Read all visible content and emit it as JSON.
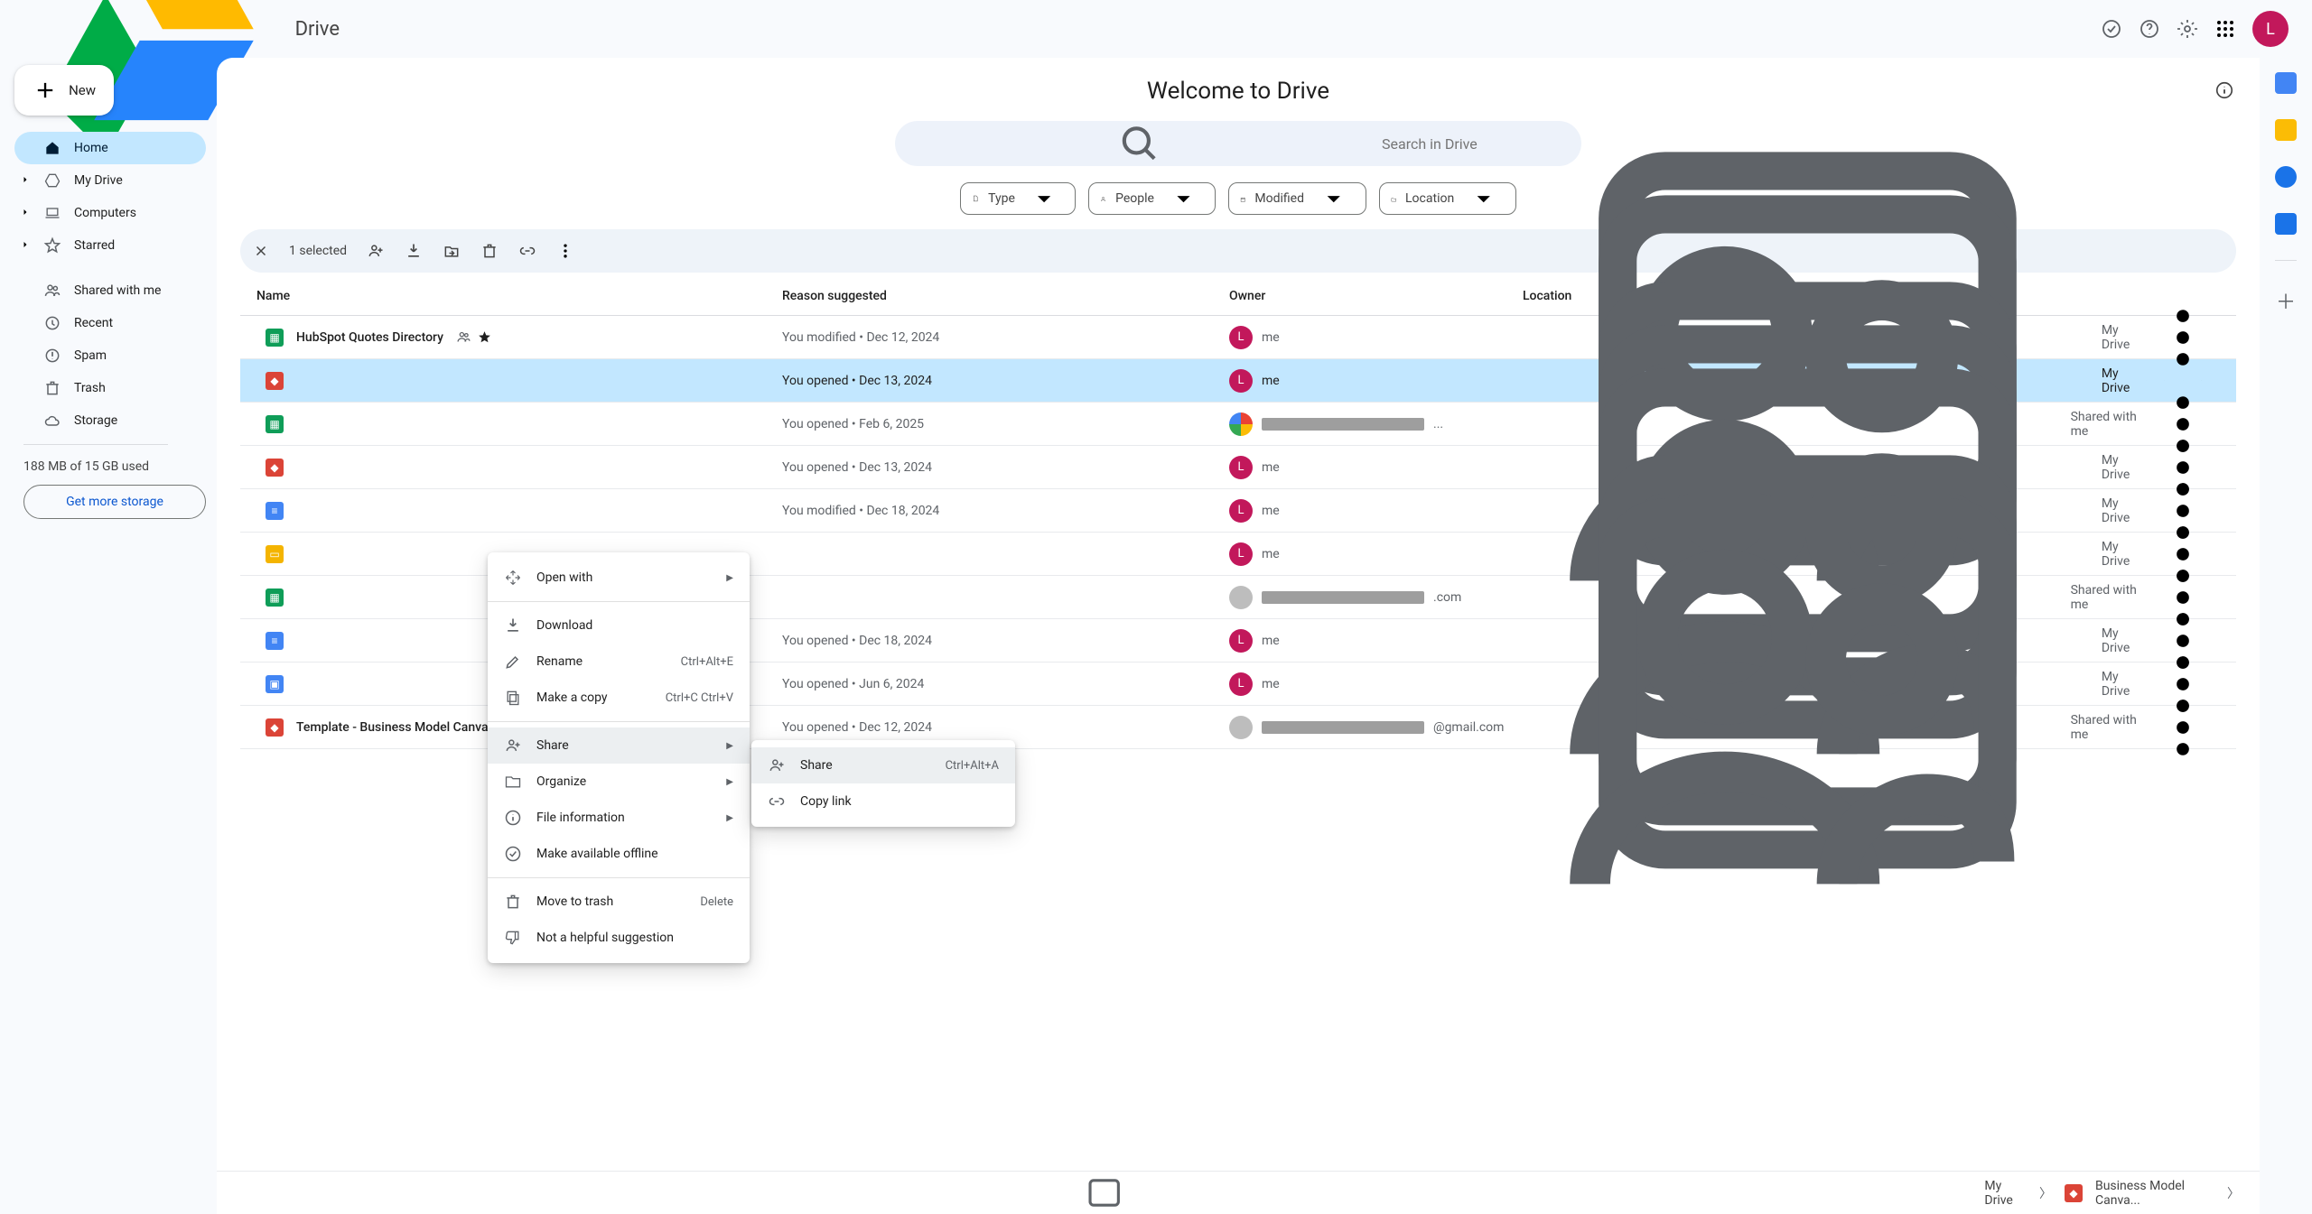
{
  "app": {
    "name": "Drive",
    "avatar_initial": "L"
  },
  "sidebar": {
    "new_label": "New",
    "items": [
      {
        "label": "Home",
        "icon": "home",
        "active": true
      },
      {
        "label": "My Drive",
        "icon": "drive",
        "expandable": true
      },
      {
        "label": "Computers",
        "icon": "computers",
        "expandable": true
      },
      {
        "label": "Starred",
        "icon": "star",
        "expandable": true
      }
    ],
    "items2": [
      {
        "label": "Shared with me",
        "icon": "group"
      },
      {
        "label": "Recent",
        "icon": "clock"
      },
      {
        "label": "Spam",
        "icon": "spam"
      },
      {
        "label": "Trash",
        "icon": "trash"
      },
      {
        "label": "Storage",
        "icon": "cloud"
      }
    ],
    "storage_text": "188 MB of 15 GB used",
    "storage_btn": "Get more storage"
  },
  "main": {
    "title": "Welcome to Drive",
    "search_placeholder": "Search in Drive",
    "chips": [
      {
        "label": "Type",
        "icon": "file"
      },
      {
        "label": "People",
        "icon": "person"
      },
      {
        "label": "Modified",
        "icon": "calendar"
      },
      {
        "label": "Location",
        "icon": "folder"
      }
    ],
    "selection_text": "1 selected",
    "columns": {
      "name": "Name",
      "reason": "Reason suggested",
      "owner": "Owner",
      "location": "Location"
    },
    "rows": [
      {
        "icon": "sheets",
        "name": "HubSpot Quotes Directory",
        "shared": true,
        "starred": true,
        "reason": "You modified • Dec 12, 2024",
        "owner_av": "L",
        "owner": "me",
        "loc_icon": "drive",
        "location": "My Drive"
      },
      {
        "icon": "draw",
        "name": "",
        "selected": true,
        "reason": "You opened • Dec 13, 2024",
        "owner_av": "L",
        "owner": "me",
        "loc_icon": "drive",
        "location": "My Drive"
      },
      {
        "icon": "sheets",
        "name": "",
        "reason": "You opened • Feb 6, 2025",
        "owner_av": "multi",
        "owner_redacted": true,
        "owner_suffix": "...",
        "loc_icon": "group",
        "location": "Shared with me"
      },
      {
        "icon": "draw",
        "name": "",
        "reason": "You opened • Dec 13, 2024",
        "owner_av": "L",
        "owner": "me",
        "loc_icon": "drive",
        "location": "My Drive"
      },
      {
        "icon": "docs",
        "name": "",
        "reason": "You modified • Dec 18, 2024",
        "owner_av": "L",
        "owner": "me",
        "loc_icon": "drive",
        "location": "My Drive"
      },
      {
        "icon": "slides",
        "name": "",
        "reason": "",
        "owner_av": "L",
        "owner": "me",
        "loc_icon": "drive",
        "location": "My Drive"
      },
      {
        "icon": "sheets",
        "name": "",
        "reason": "",
        "owner_av": "grey",
        "owner_redacted": true,
        "owner_suffix": ".com",
        "loc_icon": "group",
        "location": "Shared with me"
      },
      {
        "icon": "docs",
        "name": "",
        "reason": "You opened • Dec 18, 2024",
        "owner_av": "L",
        "owner": "me",
        "loc_icon": "drive",
        "location": "My Drive"
      },
      {
        "icon": "sites",
        "name": "",
        "reason": "You opened • Jun 6, 2024",
        "owner_av": "L",
        "owner": "me",
        "loc_icon": "drive",
        "location": "My Drive"
      },
      {
        "icon": "draw",
        "name": "Template - Business Model Canvas",
        "shared": true,
        "starred": true,
        "reason": "You opened • Dec 12, 2024",
        "owner_av": "grey",
        "owner_redacted": true,
        "owner_suffix": "@gmail.com",
        "loc_icon": "group",
        "location": "Shared with me"
      }
    ],
    "breadcrumb": {
      "root": "My Drive",
      "current": "Business Model Canva..."
    }
  },
  "context_menu": {
    "items": [
      {
        "label": "Open with",
        "icon": "open",
        "submenu": true
      },
      {
        "sep": true
      },
      {
        "label": "Download",
        "icon": "download"
      },
      {
        "label": "Rename",
        "icon": "rename",
        "shortcut": "Ctrl+Alt+E"
      },
      {
        "label": "Make a copy",
        "icon": "copy",
        "shortcut": "Ctrl+C Ctrl+V"
      },
      {
        "sep": true
      },
      {
        "label": "Share",
        "icon": "share",
        "submenu": true,
        "selected": true
      },
      {
        "label": "Organize",
        "icon": "organize",
        "submenu": true
      },
      {
        "label": "File information",
        "icon": "info",
        "submenu": true
      },
      {
        "label": "Make available offline",
        "icon": "offline"
      },
      {
        "sep": true
      },
      {
        "label": "Move to trash",
        "icon": "trash",
        "shortcut": "Delete"
      },
      {
        "label": "Not a helpful suggestion",
        "icon": "thumbdown"
      }
    ]
  },
  "share_submenu": {
    "items": [
      {
        "label": "Share",
        "icon": "share",
        "shortcut": "Ctrl+Alt+A",
        "selected": true
      },
      {
        "label": "Copy link",
        "icon": "link"
      }
    ]
  }
}
